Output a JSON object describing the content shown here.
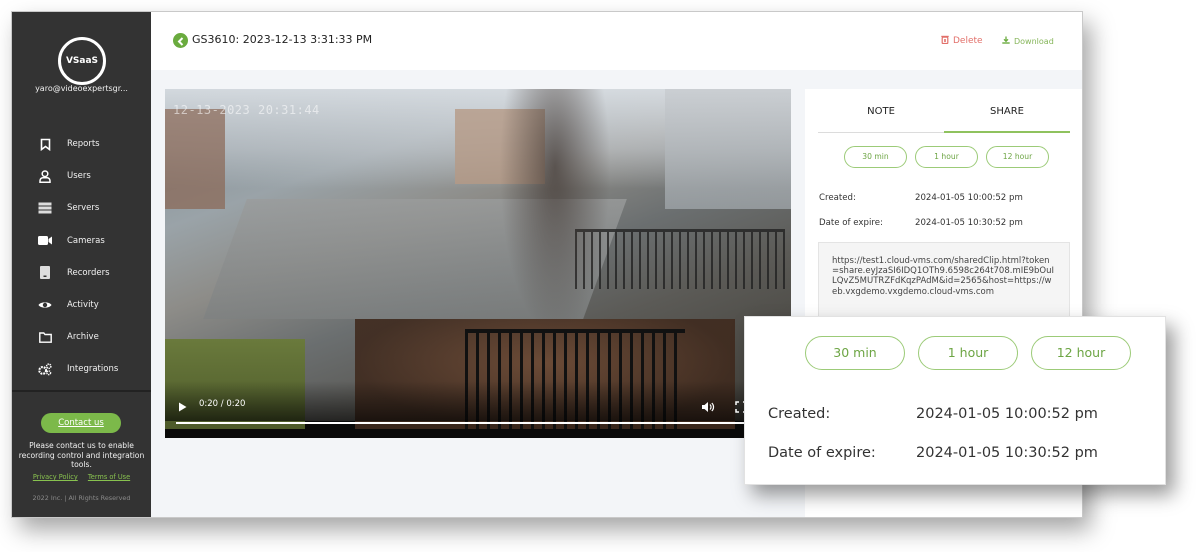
{
  "sidebar": {
    "logo_text": "VSaaS",
    "user_email": "yaro@videoexpertsgr...",
    "items": [
      {
        "label": "Reports",
        "icon": "bookmark-icon"
      },
      {
        "label": "Users",
        "icon": "user-icon"
      },
      {
        "label": "Servers",
        "icon": "server-icon"
      },
      {
        "label": "Cameras",
        "icon": "camera-icon"
      },
      {
        "label": "Recorders",
        "icon": "recorder-icon"
      },
      {
        "label": "Activity",
        "icon": "eye-icon"
      },
      {
        "label": "Archive",
        "icon": "folder-icon"
      },
      {
        "label": "Integrations",
        "icon": "gears-icon"
      }
    ],
    "contact_button": "Contact us",
    "contact_note": "Please contact us to enable recording control and integration tools.",
    "privacy_link": "Privacy Policy",
    "terms_link": "Terms of Use",
    "copyright": "2022 Inc. | All Rights Reserved"
  },
  "header": {
    "title": "GS3610: 2023-12-13 3:31:33 PM",
    "delete_label": "Delete",
    "download_label": "Download"
  },
  "video": {
    "overlay_timestamp": "12-13-2023 20:31:44",
    "time_readout": "0:20 / 0:20",
    "progress_fraction": 1.0
  },
  "share_panel": {
    "tabs": [
      {
        "label": "NOTE",
        "active": false
      },
      {
        "label": "SHARE",
        "active": true
      }
    ],
    "durations": [
      "30 min",
      "1 hour",
      "12 hour"
    ],
    "created_label": "Created:",
    "created_value": "2024-01-05 10:00:52 pm",
    "expire_label": "Date of expire:",
    "expire_value": "2024-01-05 10:30:52 pm",
    "share_link": "https://test1.cloud-vms.com/sharedClip.html?token=share.eyJzaSI6IDQ1OTh9.6598c264t708.mIE9bOuILQvZ5MUTRZFdKqzPAdM&id=2565&host=https://web.vxgdemo.vxgdemo.cloud-vms.com"
  },
  "colors": {
    "accent_green": "#7cb94a",
    "delete_red": "#e2706a",
    "sidebar_bg": "#333333"
  }
}
